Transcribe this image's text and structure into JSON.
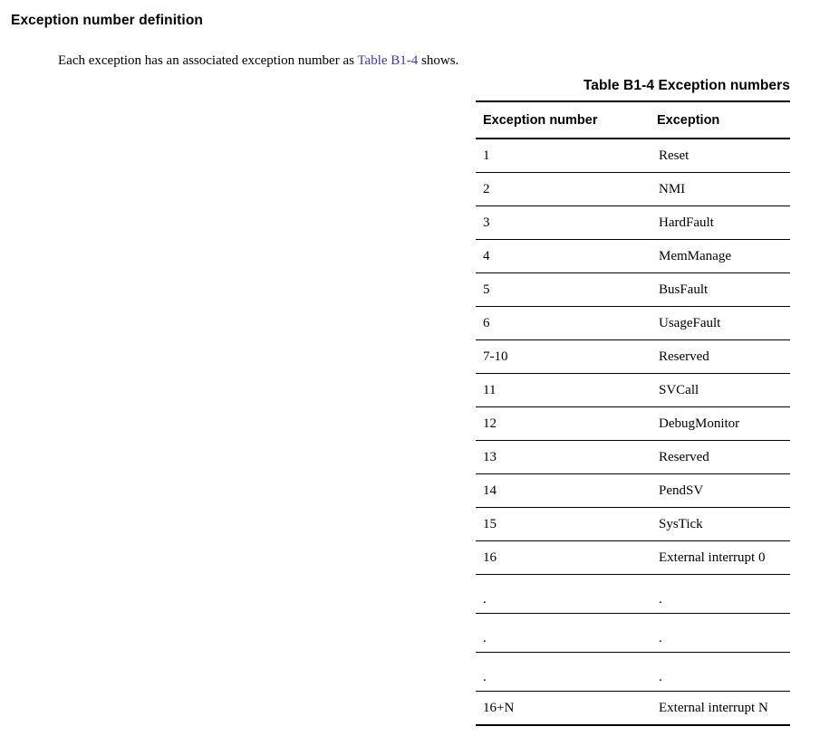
{
  "section": {
    "heading": "Exception number definition",
    "paragraph": {
      "before_link": "Each exception has an associated exception number as ",
      "link_text": "Table B1-4",
      "after_link": " shows.",
      "link_color": "#3838c0"
    }
  },
  "table": {
    "caption": "Table B1-4 Exception numbers",
    "columns": [
      "Exception number",
      "Exception"
    ],
    "rows": [
      {
        "number": "1",
        "exception": "Reset"
      },
      {
        "number": "2",
        "exception": "NMI"
      },
      {
        "number": "3",
        "exception": "HardFault"
      },
      {
        "number": "4",
        "exception": "MemManage"
      },
      {
        "number": "5",
        "exception": "BusFault"
      },
      {
        "number": "6",
        "exception": "UsageFault"
      },
      {
        "number": "7-10",
        "exception": "Reserved"
      },
      {
        "number": "11",
        "exception": "SVCall"
      },
      {
        "number": "12",
        "exception": "DebugMonitor"
      },
      {
        "number": "13",
        "exception": "Reserved"
      },
      {
        "number": "14",
        "exception": "PendSV"
      },
      {
        "number": "15",
        "exception": "SysTick"
      },
      {
        "number": "16",
        "exception": "External interrupt 0"
      },
      {
        "number": ".",
        "exception": "."
      },
      {
        "number": ".",
        "exception": "."
      },
      {
        "number": ".",
        "exception": "."
      },
      {
        "number": "16+N",
        "exception": "External interrupt N"
      }
    ]
  }
}
